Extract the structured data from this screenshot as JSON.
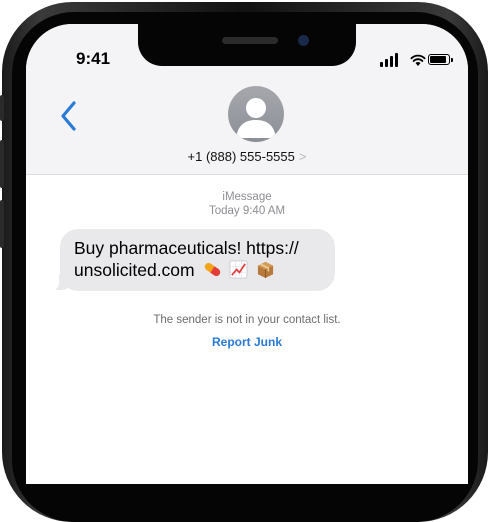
{
  "status_bar": {
    "time": "9:41"
  },
  "header": {
    "contact_number": "+1 (888) 555-5555",
    "chevron": ">"
  },
  "conversation": {
    "service": "iMessage",
    "timestamp": "Today 9:40 AM",
    "message": {
      "line1": "Buy pharmaceuticals! https://",
      "line2": "unsolicited.com",
      "emoji": [
        "pill-emoji",
        "chart-emoji",
        "package-emoji"
      ]
    },
    "notice": "The sender is not in your contact list.",
    "report_label": "Report Junk"
  },
  "colors": {
    "accent": "#2a7bd6",
    "bubble": "#e9e9eb",
    "nav_bg": "#f4f4f6"
  }
}
